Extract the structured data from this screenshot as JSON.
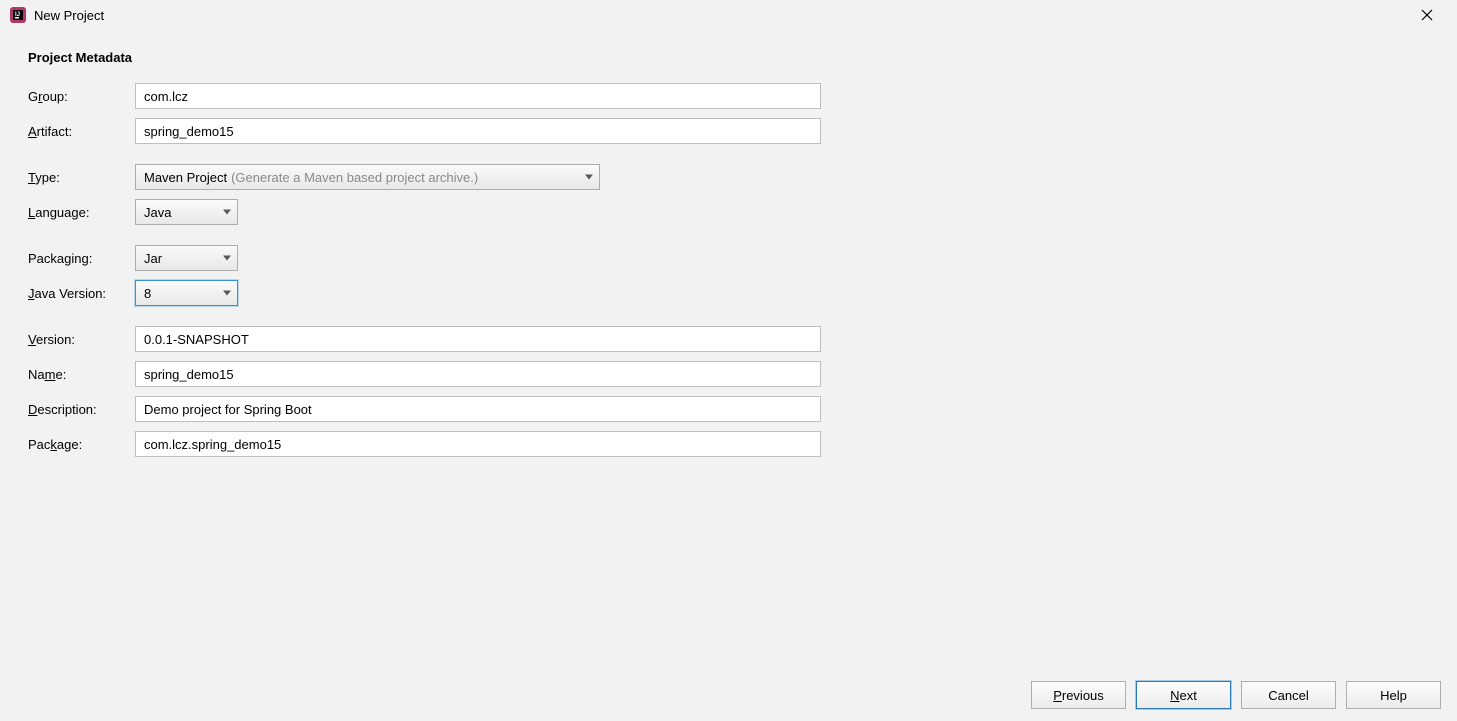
{
  "window": {
    "title": "New Project"
  },
  "section": {
    "title": "Project Metadata"
  },
  "labels": {
    "group_pre": "G",
    "group_m": "r",
    "group_post": "oup:",
    "artifact_pre": "",
    "artifact_m": "A",
    "artifact_post": "rtifact:",
    "type_pre": "",
    "type_m": "T",
    "type_post": "ype:",
    "language_pre": "",
    "language_m": "L",
    "language_post": "anguage:",
    "packaging": "Packaging:",
    "javaver_pre": "",
    "javaver_m": "J",
    "javaver_post": "ava Version:",
    "version_pre": "",
    "version_m": "V",
    "version_post": "ersion:",
    "name_pre": "Na",
    "name_m": "m",
    "name_post": "e:",
    "description_pre": "",
    "description_m": "D",
    "description_post": "escription:",
    "package_pre": "Pac",
    "package_m": "k",
    "package_post": "age:"
  },
  "fields": {
    "group": "com.lcz",
    "artifact": "spring_demo15",
    "type_value": "Maven Project",
    "type_hint": "(Generate a Maven based project archive.)",
    "language": "Java",
    "packaging": "Jar",
    "javaVersion": "8",
    "version": "0.0.1-SNAPSHOT",
    "name": "spring_demo15",
    "description": "Demo project for Spring Boot",
    "package": "com.lcz.spring_demo15"
  },
  "buttons": {
    "previous_pre": "",
    "previous_m": "P",
    "previous_post": "revious",
    "next_pre": "",
    "next_m": "N",
    "next_post": "ext",
    "cancel": "Cancel",
    "help": "Help"
  }
}
